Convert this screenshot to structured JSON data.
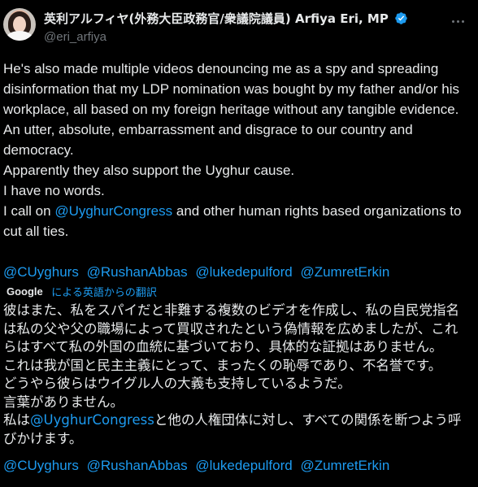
{
  "author": {
    "display_name": "英利アルフィヤ(外務大臣政務官/衆議院議員) Arfiya Eri, MP",
    "handle": "@eri_arfiya",
    "verified_icon": "verified-badge-icon",
    "verified_color": "#1d9bf0",
    "more_icon": "more-dots-icon"
  },
  "post_en": {
    "lines": [
      "He's also made multiple videos denouncing me as a spy and spreading disinformation that my LDP nomination was bought by my father and/or his workplace, all based on my foreign heritage without any tangible evidence.",
      "An utter, absolute, embarrassment and disgrace to our country and democracy.",
      "Apparently they also support the Uyghur cause.",
      "I have no words."
    ],
    "last_line_prefix": "I call on ",
    "last_line_mention": "@UyghurCongress",
    "last_line_suffix": " and other human rights based organizations to cut all ties.",
    "mentions": [
      "@CUyghurs",
      "@RushanAbbas",
      "@lukedepulford",
      "@ZumretErkin"
    ]
  },
  "translation": {
    "provider": "Google",
    "label": "による英語からの翻訳"
  },
  "post_ja": {
    "lines": [
      "彼はまた、私をスパイだと非難する複数のビデオを作成し、私の自民党指名は私の父や父の職場によって買収されたという偽情報を広めましたが、これらはすべて私の外国の血統に基づいており、具体的な証拠はありません。",
      "これは我が国と民主主義にとって、まったくの恥辱であり、不名誉です。",
      "どうやら彼らはウイグル人の大義も支持しているようだ。",
      "言葉がありません。"
    ],
    "last_line_prefix": "私は",
    "last_line_mention": "@UyghurCongress",
    "last_line_suffix": "と他の人権団体に対し、すべての関係を断つよう呼びかけます。",
    "mentions": [
      "@CUyghurs",
      "@RushanAbbas",
      "@lukedepulford",
      "@ZumretErkin"
    ]
  },
  "colors": {
    "background": "#000000",
    "text": "#e7e9ea",
    "secondary": "#71767b",
    "link": "#1d9bf0"
  }
}
